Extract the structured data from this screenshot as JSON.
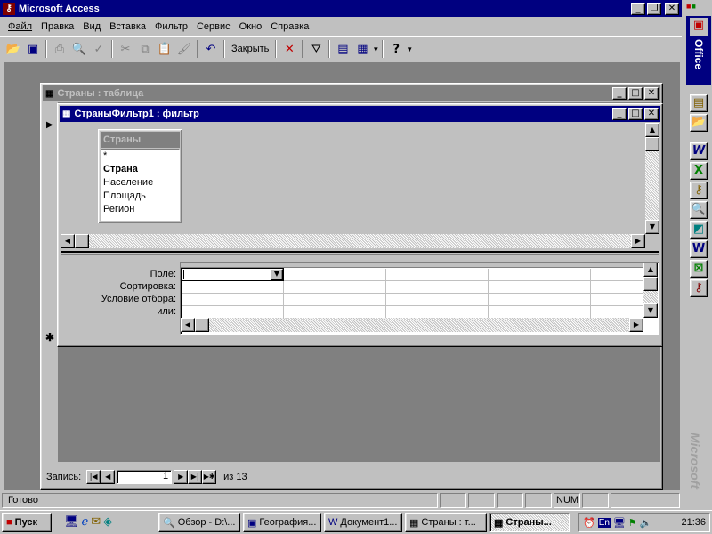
{
  "app": {
    "title": "Microsoft Access"
  },
  "menu": [
    "Файл",
    "Правка",
    "Вид",
    "Вставка",
    "Фильтр",
    "Сервис",
    "Окно",
    "Справка"
  ],
  "toolbar": {
    "close_label": "Закрыть"
  },
  "table_window": {
    "title": "Страны : таблица"
  },
  "filter_window": {
    "title": "СтраныФильтр1 : фильтр",
    "field_list": {
      "title": "Страны",
      "items": [
        "*",
        "Страна",
        "Население",
        "Площадь",
        "Регион"
      ]
    },
    "grid_labels": [
      "Поле:",
      "Сортировка:",
      "Условие отбора:",
      "или:"
    ]
  },
  "record_nav": {
    "label": "Запись:",
    "current": "1",
    "of": "из 13"
  },
  "status": {
    "text": "Готово",
    "num": "NUM"
  },
  "office_bar": {
    "label": "Office",
    "microsoft": "Microsoft"
  },
  "taskbar": {
    "start": "Пуск",
    "tasks": [
      "Обзор - D:\\...",
      "География...",
      "Документ1...",
      "Страны : т...",
      "Страны..."
    ],
    "lang": "En",
    "clock": "21:36"
  }
}
